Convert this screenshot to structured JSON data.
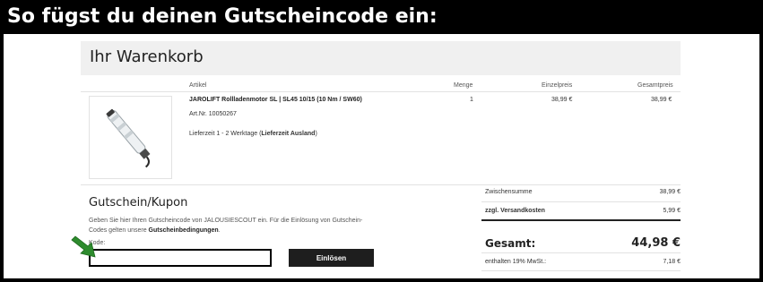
{
  "banner": {
    "title": "So fügst du deinen Gutscheincode ein:"
  },
  "cart": {
    "title": "Ihr Warenkorb",
    "columns": {
      "article": "Artikel",
      "quantity": "Menge",
      "unit_price": "Einzelpreis",
      "total_price": "Gesamtpreis"
    },
    "item": {
      "name": "JAROLIFT Rollladenmotor SL | SL45 10/15 (10 Nm / SW60)",
      "article_no": "Art.Nr. 10050267",
      "delivery_prefix": "Lieferzeit 1 - 2 Werktage (",
      "delivery_bold": "Lieferzeit Ausland",
      "delivery_suffix": ")",
      "quantity": "1",
      "unit_price": "38,99 €",
      "total_price": "38,99 €"
    }
  },
  "coupon": {
    "title": "Gutschein/Kupon",
    "description_prefix": "Geben Sie hier Ihren Gutscheincode von JALOUSIESCOUT ein. Für die Einlösung von Gutschein-Codes gelten unsere ",
    "description_bold": "Gutscheinbedingungen",
    "description_suffix": ".",
    "code_label": "Kode:",
    "code_value": "",
    "redeem_label": "Einlösen"
  },
  "summary": {
    "subtotal_label": "Zwischensumme",
    "subtotal_value": "38,99 €",
    "shipping_label": "zzgl. Versandkosten",
    "shipping_value": "5,99 €",
    "total_label": "Gesamt:",
    "total_value": "44,98 €",
    "vat_label": "enthalten 19% MwSt.:",
    "vat_value": "7,18 €"
  },
  "icons": {
    "arrow": "green-arrow-icon",
    "product": "tube-motor-image"
  },
  "colors": {
    "arrow": "#2e8b2e",
    "button": "#1e1e1e",
    "header_bg": "#f0f0f0"
  }
}
